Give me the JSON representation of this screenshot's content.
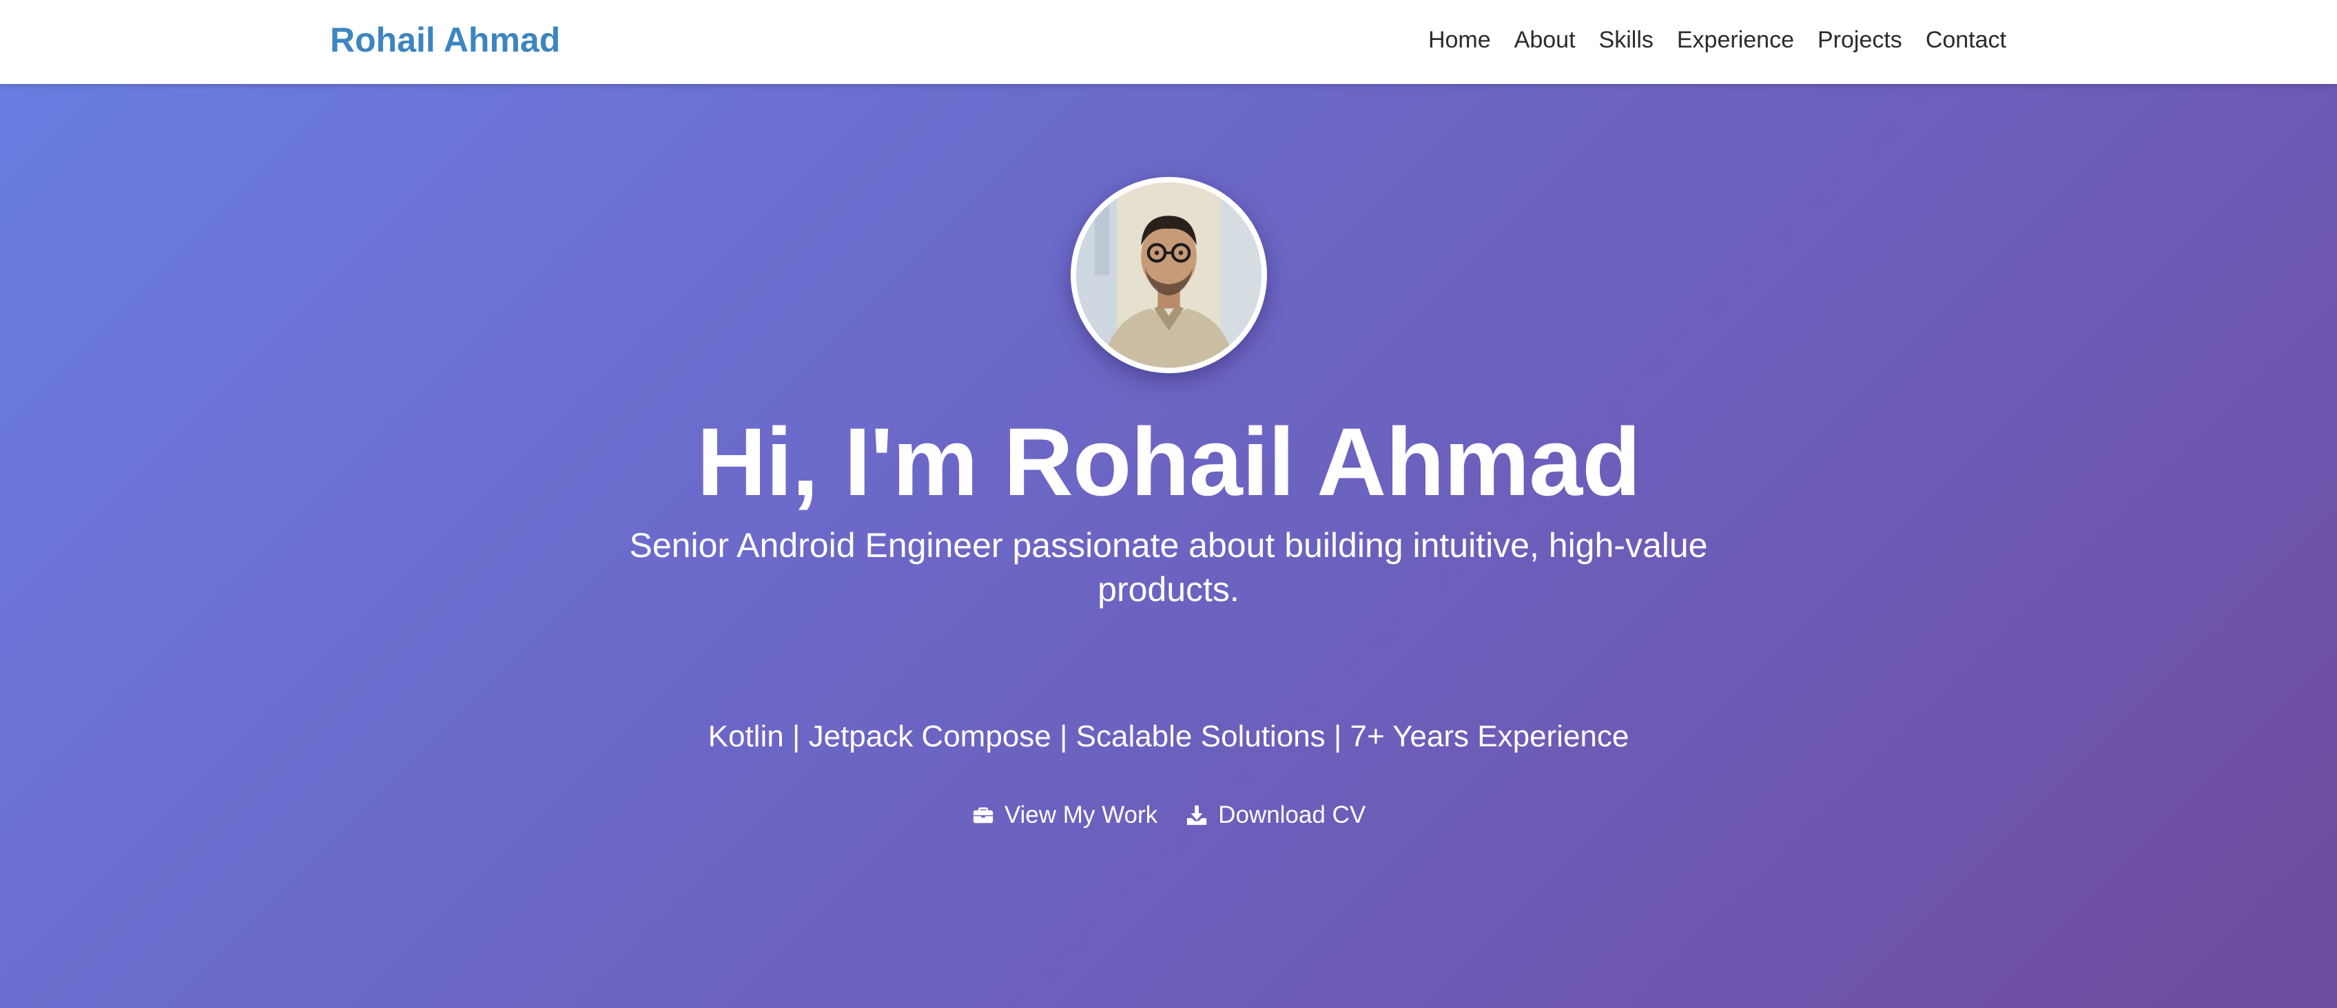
{
  "navbar": {
    "brand": "Rohail Ahmad",
    "links": [
      "Home",
      "About",
      "Skills",
      "Experience",
      "Projects",
      "Contact"
    ]
  },
  "hero": {
    "title": "Hi, I'm Rohail Ahmad",
    "subtitle": "Senior Android Engineer passionate about building intuitive, high-value products.",
    "tags": "Kotlin | Jetpack Compose | Scalable Solutions | 7+ Years Experience",
    "actions": {
      "view_work": {
        "label": "View My Work",
        "icon": "briefcase-icon"
      },
      "download_cv": {
        "label": "Download CV",
        "icon": "download-icon"
      }
    }
  },
  "colors": {
    "brand": "#3d85c0",
    "gradient_start": "#6a7de0",
    "gradient_end": "#6e4c9f",
    "nav_text": "#2b2b2b"
  }
}
